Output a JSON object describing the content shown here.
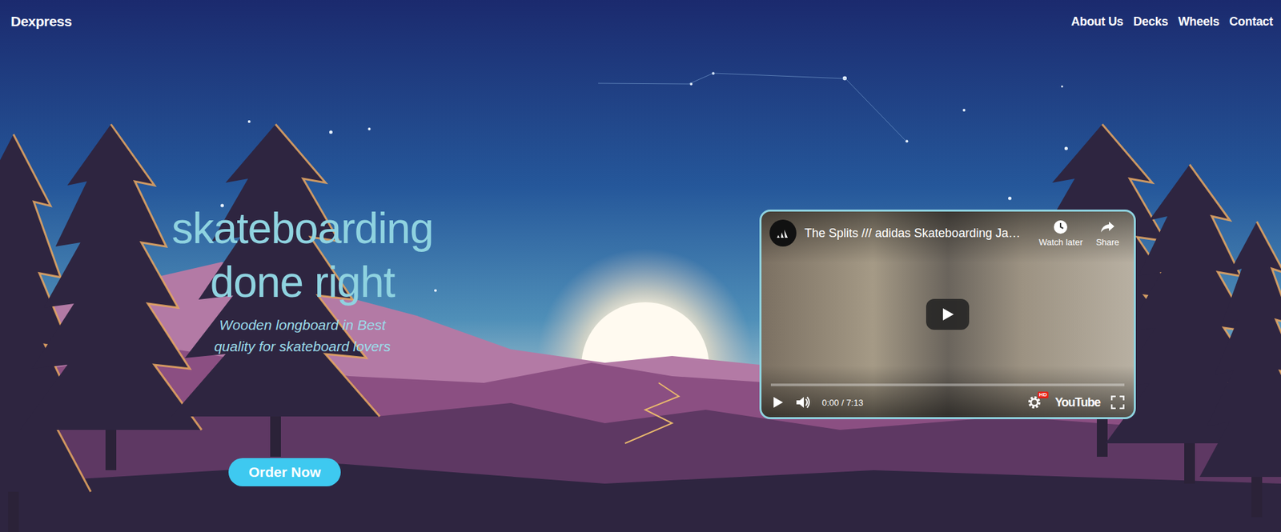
{
  "brand": "Dexpress",
  "nav": [
    {
      "label": "About Us"
    },
    {
      "label": "Decks"
    },
    {
      "label": "Wheels"
    },
    {
      "label": "Contact"
    }
  ],
  "hero": {
    "title": "skateboarding done right",
    "subtitle": "Wooden longboard in Best quality for skateboard lovers",
    "button": "Order Now"
  },
  "video": {
    "title": "The Splits /// adidas Skateboarding Ja…",
    "actions": [
      "Watch later",
      "Share"
    ],
    "time": "0:00 / 7:13",
    "logo": "YouTube",
    "hd": "HD",
    "playing": false,
    "level": 0
  }
}
